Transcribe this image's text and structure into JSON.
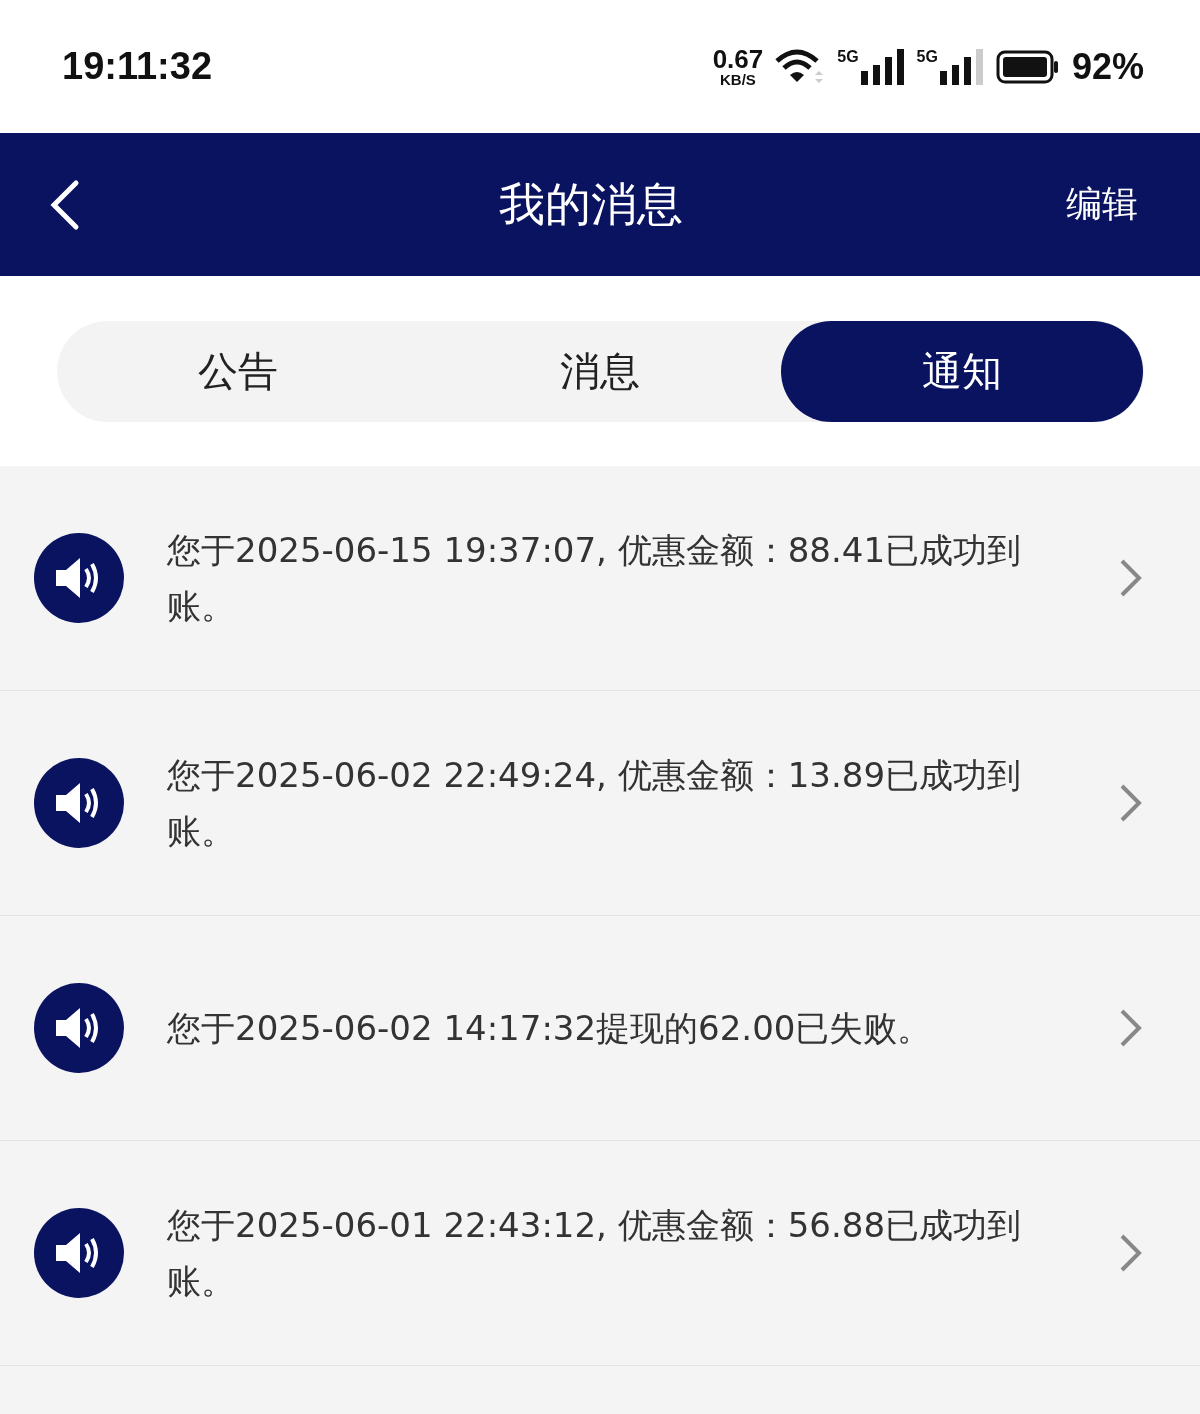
{
  "status_bar": {
    "time": "19:11:32",
    "speed": "0.67",
    "speed_unit": "KB/S",
    "networks": [
      {
        "label": "5G"
      },
      {
        "label": "5G"
      }
    ],
    "battery": "92%"
  },
  "header": {
    "title": "我的消息",
    "action": "编辑"
  },
  "tabs": [
    {
      "label": "公告",
      "selected": false
    },
    {
      "label": "消息",
      "selected": false
    },
    {
      "label": "通知",
      "selected": true
    }
  ],
  "notifications": [
    {
      "text": "您于2025-06-15 19:37:07, 优惠金额：88.41已成功到账。"
    },
    {
      "text": "您于2025-06-02 22:49:24, 优惠金额：13.89已成功到账。"
    },
    {
      "text": "您于2025-06-02 14:17:32提现的62.00已失败。"
    },
    {
      "text": "您于2025-06-01 22:43:12, 优惠金额：56.88已成功到账。"
    }
  ]
}
